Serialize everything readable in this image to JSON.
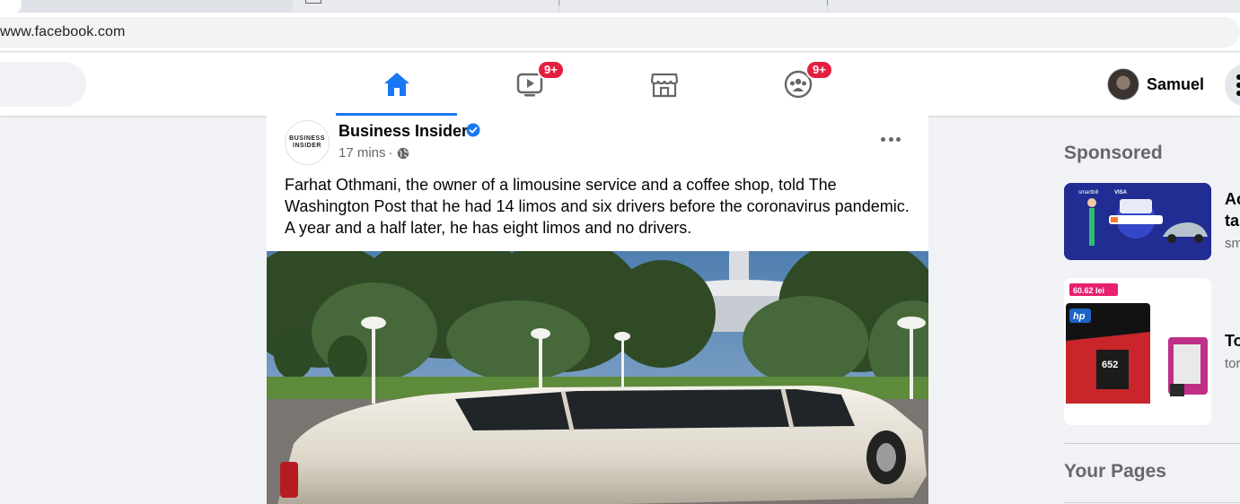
{
  "browser": {
    "url": "www.facebook.com"
  },
  "nav": {
    "tabs": [
      {
        "name": "home",
        "icon": "home-icon",
        "badge": ""
      },
      {
        "name": "watch",
        "icon": "video-icon",
        "badge": "9+"
      },
      {
        "name": "marketplace",
        "icon": "store-icon",
        "badge": ""
      },
      {
        "name": "groups",
        "icon": "groups-icon",
        "badge": "9+"
      }
    ],
    "profile_name": "Samuel",
    "accent": "#1877f2",
    "badge_color": "#e41e3f"
  },
  "post": {
    "page_logo_text": "BUSINESS\nINSIDER",
    "page_name": "Business Insider",
    "time": "17 mins",
    "separator": "·",
    "text": "Farhat Othmani, the owner of a limousine service and a coffee shop, told The Washington Post that he had 14 limos and six drivers before the coronavirus pandemic. A year and a half later, he has eight limos and no drivers."
  },
  "sidebar": {
    "sponsored_heading": "Sponsored",
    "ads": [
      {
        "title_1": "Ac",
        "title_2": "ta",
        "subtitle": "sm",
        "image_label_1": "smartbill",
        "image_label_2": "VISA"
      },
      {
        "title_1": "To",
        "title_2": "",
        "subtitle": "tor",
        "price_tag": "60.62 lei",
        "cart_label": "652",
        "brand": "hp"
      }
    ],
    "your_pages_heading": "Your Pages"
  }
}
